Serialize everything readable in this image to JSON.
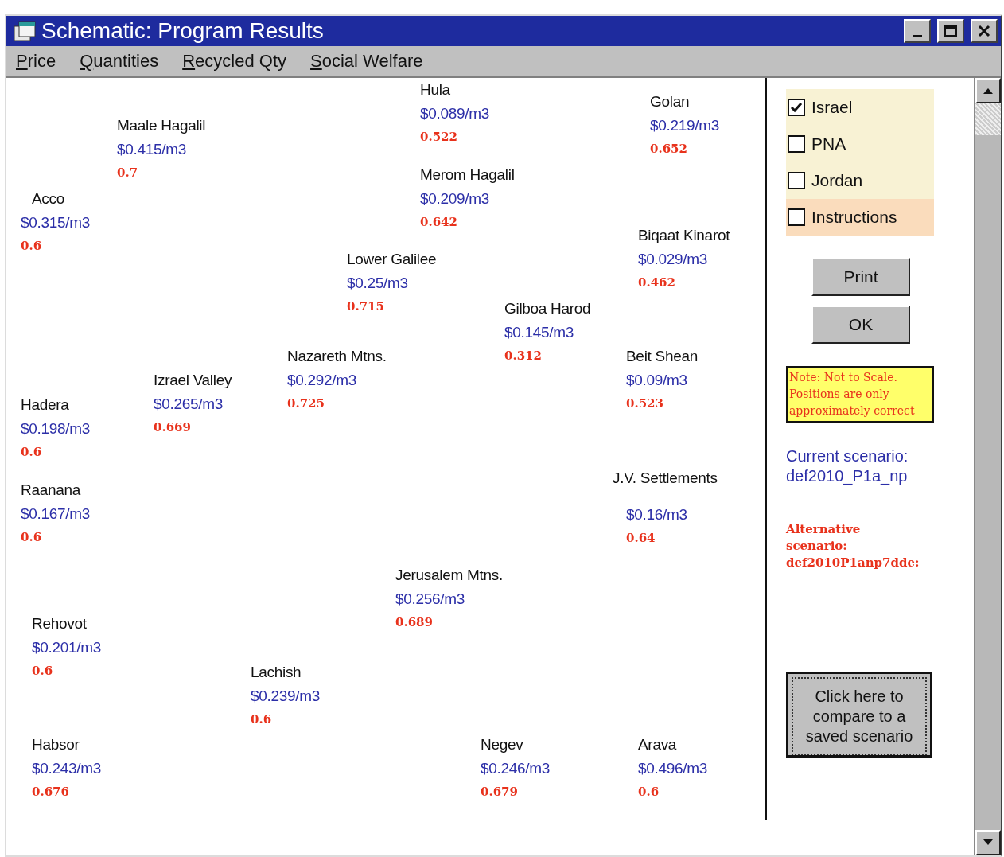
{
  "window": {
    "title": "Schematic: Program Results"
  },
  "menu": [
    {
      "label": "Price"
    },
    {
      "label": "Quantities"
    },
    {
      "label": "Recycled Qty"
    },
    {
      "label": "Social Welfare"
    }
  ],
  "nodes": [
    {
      "name": "Hula",
      "price": "$0.089/m3",
      "ratio": "0.522"
    },
    {
      "name": "Golan",
      "price": "$0.219/m3",
      "ratio": "0.652"
    },
    {
      "name": "Maale Hagalil",
      "price": "$0.415/m3",
      "ratio": "0.7"
    },
    {
      "name": "Merom Hagalil",
      "price": "$0.209/m3",
      "ratio": "0.642"
    },
    {
      "name": "Acco",
      "price": "$0.315/m3",
      "ratio": "0.6"
    },
    {
      "name": "Biqaat Kinarot",
      "price": "$0.029/m3",
      "ratio": "0.462"
    },
    {
      "name": "Lower Galilee",
      "price": "$0.25/m3",
      "ratio": "0.715"
    },
    {
      "name": "Gilboa Harod",
      "price": "$0.145/m3",
      "ratio": "0.312"
    },
    {
      "name": "Nazareth Mtns.",
      "price": "$0.292/m3",
      "ratio": "0.725"
    },
    {
      "name": "Beit Shean",
      "price": "$0.09/m3",
      "ratio": "0.523"
    },
    {
      "name": "Izrael Valley",
      "price": "$0.265/m3",
      "ratio": "0.669"
    },
    {
      "name": "Hadera",
      "price": "$0.198/m3",
      "ratio": "0.6"
    },
    {
      "name": "Raanana",
      "price": "$0.167/m3",
      "ratio": "0.6"
    },
    {
      "name": "J.V. Settlements",
      "price": "$0.16/m3",
      "ratio": "0.64"
    },
    {
      "name": "Jerusalem Mtns.",
      "price": "$0.256/m3",
      "ratio": "0.689"
    },
    {
      "name": "Rehovot",
      "price": "$0.201/m3",
      "ratio": "0.6"
    },
    {
      "name": "Lachish",
      "price": "$0.239/m3",
      "ratio": "0.6"
    },
    {
      "name": "Habsor",
      "price": "$0.243/m3",
      "ratio": "0.676"
    },
    {
      "name": "Negev",
      "price": "$0.246/m3",
      "ratio": "0.679"
    },
    {
      "name": "Arava",
      "price": "$0.496/m3",
      "ratio": "0.6"
    }
  ],
  "filters": [
    {
      "label": "Israel",
      "checked": true,
      "color": "#f8f2d4"
    },
    {
      "label": "PNA",
      "checked": false,
      "color": "#f8f2d4"
    },
    {
      "label": "Jordan",
      "checked": false,
      "color": "#f8f2d4"
    },
    {
      "label": "Instructions",
      "checked": false,
      "color": "#fadcbc"
    }
  ],
  "buttons": [
    {
      "label": "Print"
    },
    {
      "label": "OK"
    }
  ],
  "note": "Note: Not to Scale. Positions are only approximately correct",
  "current_scenario": {
    "label": "Current scenario:",
    "value": "def2010_P1a_np"
  },
  "alternative_scenario": {
    "label": "Alternative scenario:",
    "value": "def2010P1anp7dde:"
  },
  "compare_button": "Click here to compare to a saved scenario"
}
